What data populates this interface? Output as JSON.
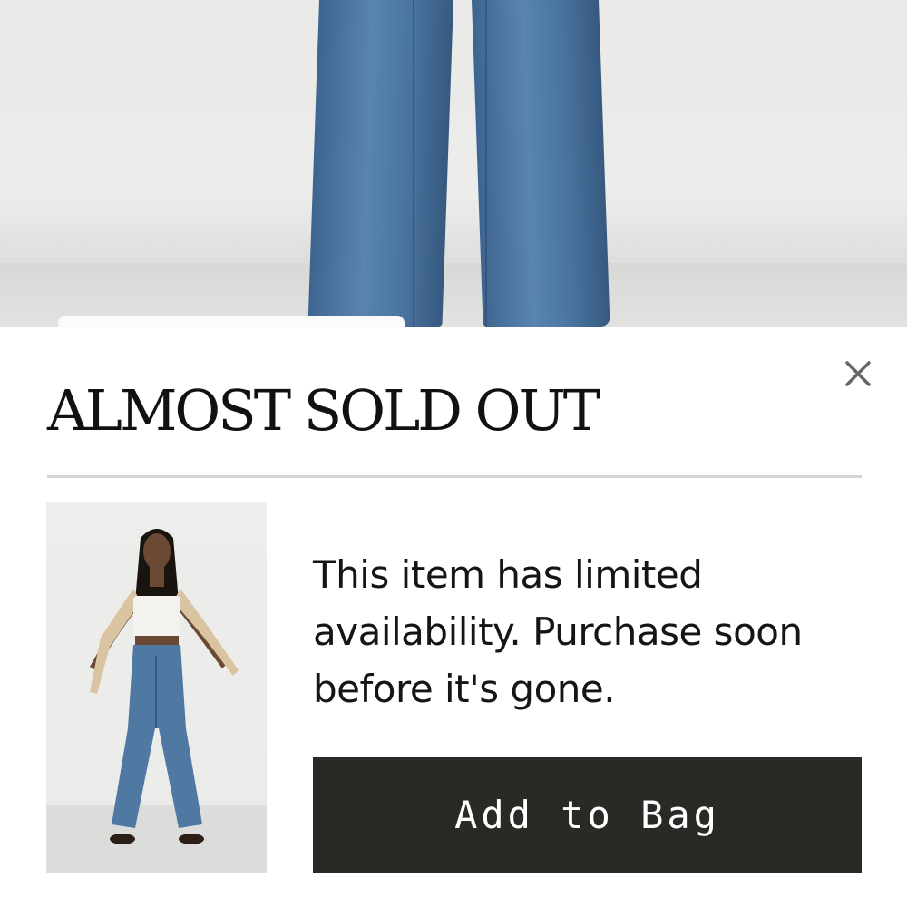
{
  "sheet": {
    "title": "ALMOST SOLD OUT",
    "message": "This item has limited availability. Purchase soon before it's gone.",
    "add_to_bag_label": "Add to Bag",
    "close_icon": "close-icon"
  },
  "colors": {
    "button_bg": "#2b2926",
    "button_text": "#ffffff",
    "title_text": "#111111",
    "divider": "#d4d4d4"
  }
}
